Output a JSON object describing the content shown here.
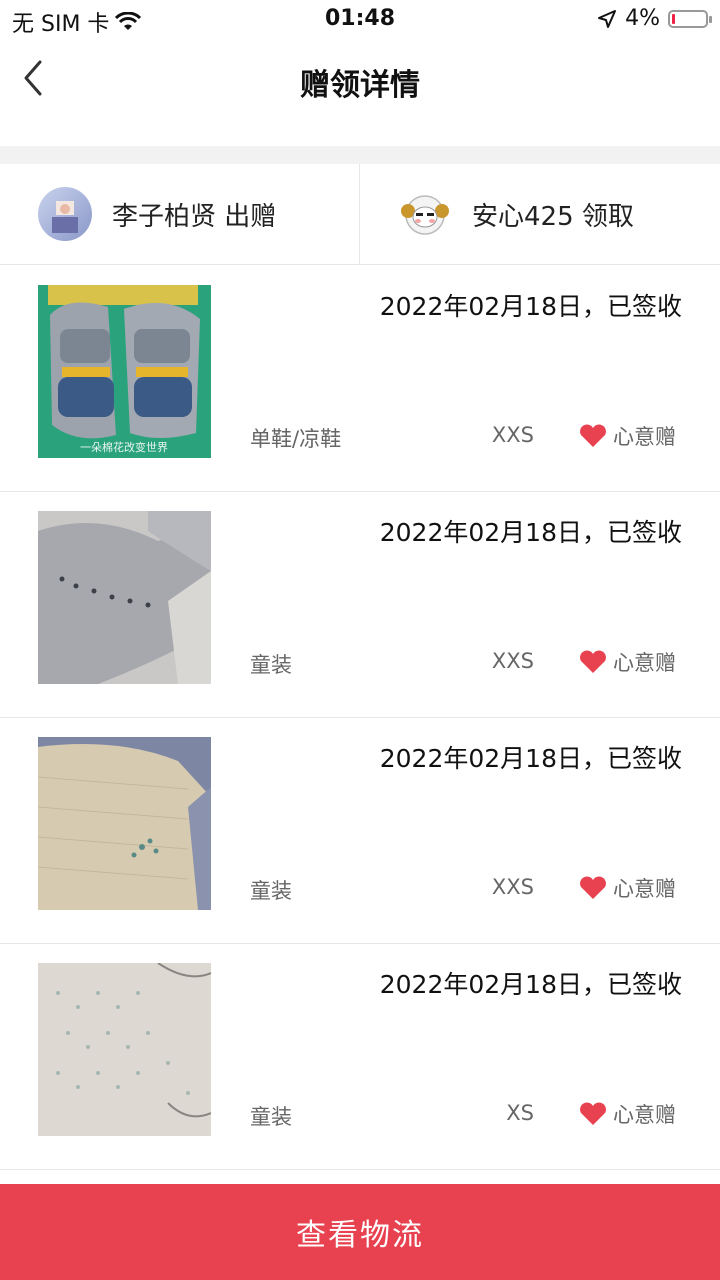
{
  "status_bar": {
    "carrier": "无 SIM 卡",
    "time": "01:48",
    "battery": "4%"
  },
  "nav": {
    "title": "赠领详情"
  },
  "donor": {
    "label": "李子柏贤 出赠"
  },
  "receiver": {
    "label": "安心425 领取"
  },
  "items": [
    {
      "date": "2022年02月18日，已签收",
      "category": "单鞋/凉鞋",
      "size": "XXS",
      "gift_type": "心意赠",
      "watermark": "一朵棉花改变世界"
    },
    {
      "date": "2022年02月18日，已签收",
      "category": "童装",
      "size": "XXS",
      "gift_type": "心意赠"
    },
    {
      "date": "2022年02月18日，已签收",
      "category": "童装",
      "size": "XXS",
      "gift_type": "心意赠"
    },
    {
      "date": "2022年02月18日，已签收",
      "category": "童装",
      "size": "XS",
      "gift_type": "心意赠"
    }
  ],
  "bottom_button": {
    "label": "查看物流"
  },
  "colors": {
    "accent": "#e8414f",
    "heart": "#e8414f"
  }
}
